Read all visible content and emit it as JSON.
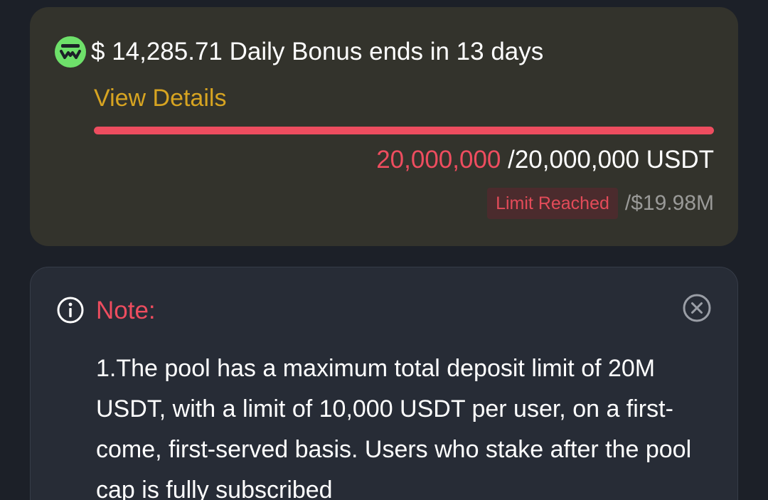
{
  "bonus": {
    "icon": "brand-logo-icon",
    "headline": "$ 14,285.71 Daily Bonus ends in 13 days",
    "view_details": "View Details",
    "progress_fraction": 1.0,
    "amount_current": "20,000,000",
    "amount_total": " /20,000,000 USDT",
    "limit_badge": "Limit Reached",
    "limit_value": "/$19.98M"
  },
  "note": {
    "info_icon": "info-icon",
    "title": "Note:",
    "close_icon": "close-icon",
    "body": "1.The pool has a maximum total deposit limit of 20M USDT, with a limit of 10,000 USDT per user, on a first-come, first-served basis. Users who stake after the pool cap is fully subscribed"
  },
  "colors": {
    "background": "#1c2028",
    "bonus_card": "#33332c",
    "note_card": "#272c36",
    "accent_red": "#ee4d5f",
    "accent_gold": "#d7a421",
    "brand_green": "#6ee06a"
  }
}
